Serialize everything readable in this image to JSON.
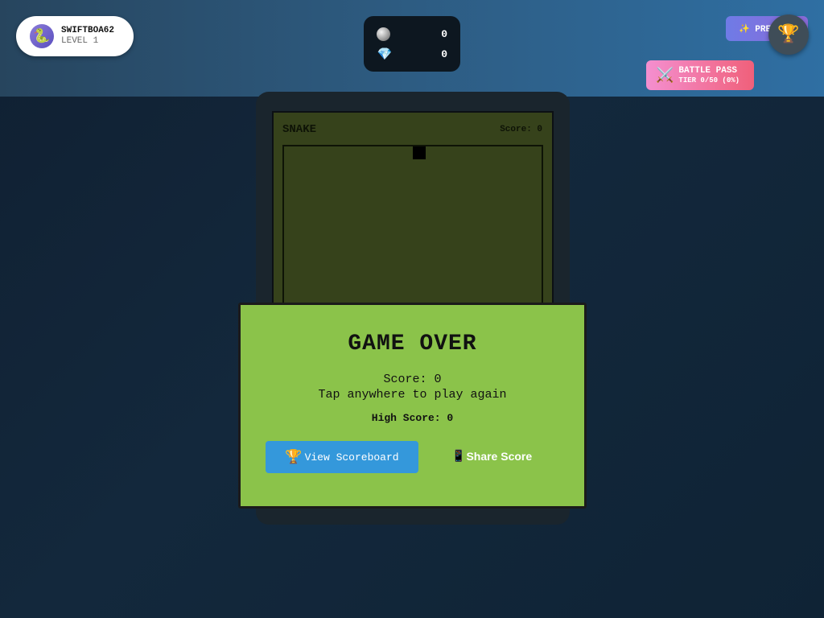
{
  "player": {
    "avatar_icon": "🐍",
    "name": "SWIFTBOA62",
    "level": "LEVEL 1"
  },
  "currency": [
    {
      "icon": "coin-icon",
      "value": "0"
    },
    {
      "icon": "gem-icon",
      "glyph": "💎",
      "value": "0"
    }
  ],
  "premium": {
    "label": "✨ PREMIUM"
  },
  "trophy": {
    "glyph": "🏆"
  },
  "battle_pass": {
    "glyph": "⚔️",
    "title": "BATTLE PASS",
    "tier": "TIER 0/50 (0%)"
  },
  "game": {
    "title": "SNAKE",
    "score_text": "Score: 0"
  },
  "game_over": {
    "title": "GAME OVER",
    "score": "Score: 0",
    "prompt": "Tap anywhere to play again",
    "high_score": "High Score: 0",
    "scoreboard_icon": "🏆",
    "scoreboard_label": "View Scoreboard",
    "share_icon": "📱",
    "share_label": "Share Score"
  },
  "colors": {
    "modal_bg": "#8bc34a",
    "scoreboard_button": "#3498db",
    "screen_bg": "#36421b"
  }
}
